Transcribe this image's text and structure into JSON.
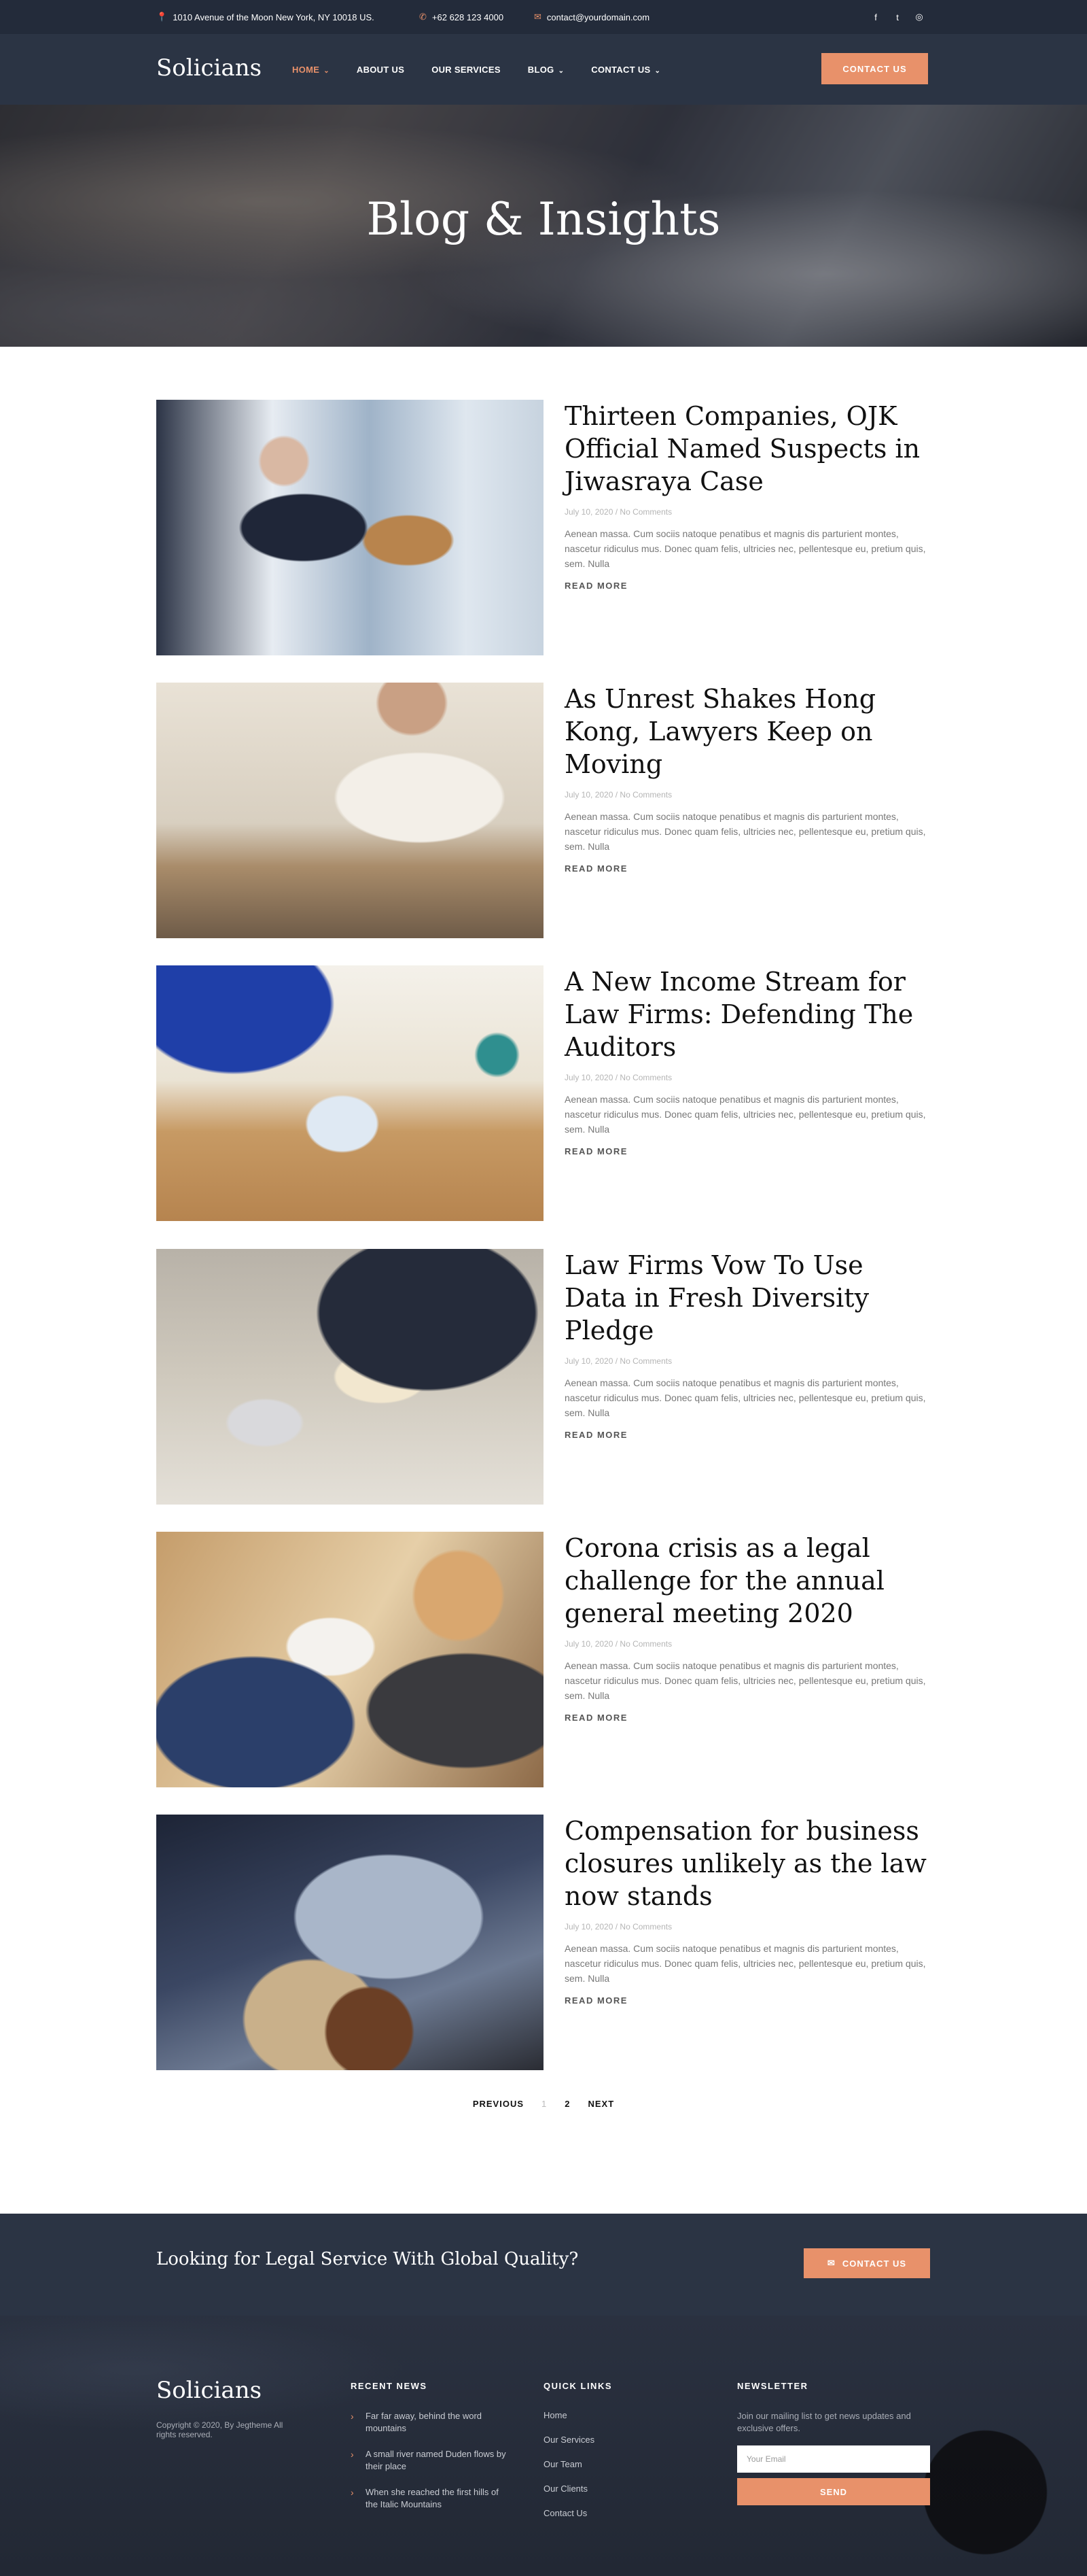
{
  "topbar": {
    "address": "1010 Avenue of the Moon New York, NY 10018 US.",
    "phone": "+62 628 123 4000",
    "email": "contact@yourdomain.com",
    "social": [
      "f",
      "t",
      "◎"
    ]
  },
  "nav": {
    "logo": "Solicians",
    "items": [
      {
        "label": "HOME",
        "dropdown": true,
        "active": true
      },
      {
        "label": "ABOUT US",
        "dropdown": false
      },
      {
        "label": "OUR SERVICES",
        "dropdown": false
      },
      {
        "label": "BLOG",
        "dropdown": true
      },
      {
        "label": "CONTACT US",
        "dropdown": true
      }
    ],
    "cta": "CONTACT US"
  },
  "hero": {
    "title": "Blog & Insights"
  },
  "posts": [
    {
      "title": "Thirteen Companies, OJK Official Named Suspects in Jiwasraya Case",
      "date": "July 10, 2020",
      "comments": "No Comments",
      "excerpt": "Aenean massa. Cum sociis natoque penatibus et magnis dis parturient montes, nascetur ridiculus mus. Donec quam felis, ultricies nec, pellentesque eu, pretium quis, sem. Nulla",
      "more": "READ MORE"
    },
    {
      "title": "As Unrest Shakes Hong Kong, Lawyers Keep on Moving",
      "date": "July 10, 2020",
      "comments": "No Comments",
      "excerpt": "Aenean massa. Cum sociis natoque penatibus et magnis dis parturient montes, nascetur ridiculus mus. Donec quam felis, ultricies nec, pellentesque eu, pretium quis, sem. Nulla",
      "more": "READ MORE"
    },
    {
      "title": "A New Income Stream for Law Firms: Defending The Auditors",
      "date": "July 10, 2020",
      "comments": "No Comments",
      "excerpt": "Aenean massa. Cum sociis natoque penatibus et magnis dis parturient montes, nascetur ridiculus mus. Donec quam felis, ultricies nec, pellentesque eu, pretium quis, sem. Nulla",
      "more": "READ MORE"
    },
    {
      "title": "Law Firms Vow To Use Data in Fresh Diversity Pledge",
      "date": "July 10, 2020",
      "comments": "No Comments",
      "excerpt": "Aenean massa. Cum sociis natoque penatibus et magnis dis parturient montes, nascetur ridiculus mus. Donec quam felis, ultricies nec, pellentesque eu, pretium quis, sem. Nulla",
      "more": "READ MORE"
    },
    {
      "title": "Corona crisis as a legal challenge for the annual general meeting 2020",
      "date": "July 10, 2020",
      "comments": "No Comments",
      "excerpt": "Aenean massa. Cum sociis natoque penatibus et magnis dis parturient montes, nascetur ridiculus mus. Donec quam felis, ultricies nec, pellentesque eu, pretium quis, sem. Nulla",
      "more": "READ MORE"
    },
    {
      "title": "Compensation for business closures unlikely as the law now stands",
      "date": "July 10, 2020",
      "comments": "No Comments",
      "excerpt": "Aenean massa. Cum sociis natoque penatibus et magnis dis parturient montes, nascetur ridiculus mus. Donec quam felis, ultricies nec, pellentesque eu, pretium quis, sem. Nulla",
      "more": "READ MORE"
    }
  ],
  "pagination": {
    "previous": "PREVIOUS",
    "pages": [
      "1",
      "2"
    ],
    "current": "1",
    "next": "NEXT"
  },
  "cta_band": {
    "text": "Looking for Legal Service With Global Quality?",
    "button": "CONTACT US"
  },
  "footer": {
    "logo": "Solicians",
    "copyright": "Copyright © 2020, By Jegtheme All rights reserved.",
    "news_title": "RECENT NEWS",
    "news": [
      "Far far away, behind the word mountains",
      "A small river named Duden flows by their place",
      "When she reached the first hills of the Italic Mountains"
    ],
    "links_title": "QUICK LINKS",
    "links": [
      "Home",
      "Our Services",
      "Our Team",
      "Our Clients",
      "Contact Us"
    ],
    "newsletter_title": "NEWSLETTER",
    "newsletter_text": "Join our mailing list to get news updates and exclusive offers.",
    "email_placeholder": "Your Email",
    "send": "SEND"
  },
  "colors": {
    "accent": "#e8916a",
    "navy": "#2b3444",
    "topbar": "#232b3a"
  }
}
